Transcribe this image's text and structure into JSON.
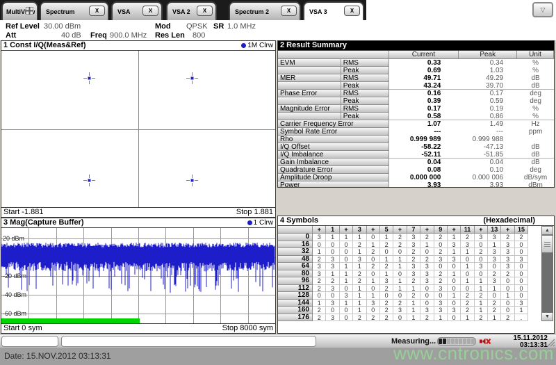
{
  "tabs": {
    "close_label": "X",
    "items": [
      {
        "label": "MultiView",
        "active": false,
        "closable": false
      },
      {
        "label": "Spectrum",
        "active": false,
        "closable": true
      },
      {
        "label": "VSA",
        "active": false,
        "closable": true
      },
      {
        "label": "VSA 2",
        "active": false,
        "closable": true
      },
      {
        "label": "Spectrum 2",
        "active": false,
        "closable": true
      },
      {
        "label": "VSA 3",
        "active": true,
        "closable": true
      }
    ]
  },
  "header": {
    "ref_level_label": "Ref Level",
    "ref_level_value": "30.00 dBm",
    "att_label": "Att",
    "att_value": "40 dB",
    "freq_label": "Freq",
    "freq_value": "900.0 MHz",
    "mod_label": "Mod",
    "mod_value": "QPSK",
    "sr_label": "SR",
    "sr_value": "1.0 MHz",
    "res_len_label": "Res Len",
    "res_len_value": "800"
  },
  "const_window": {
    "title": "1 Const I/Q(Meas&Ref)",
    "trace_label": "1M Clrw",
    "start_label": "Start -1.881",
    "stop_label": "Stop 1.881",
    "points": [
      {
        "x": 0.32,
        "y": 0.175
      },
      {
        "x": 0.695,
        "y": 0.175
      },
      {
        "x": 0.32,
        "y": 0.825
      },
      {
        "x": 0.695,
        "y": 0.825
      }
    ]
  },
  "result_summary": {
    "title": "2 Result Summary",
    "columns": [
      "Current",
      "Peak",
      "Unit"
    ],
    "rows": [
      {
        "label": "EVM",
        "sub": "RMS",
        "current": "0.33",
        "peak": "0.34",
        "unit": "%",
        "span": false,
        "group_end": false
      },
      {
        "label": "",
        "sub": "Peak",
        "current": "0.69",
        "peak": "1.03",
        "unit": "%",
        "span": false,
        "group_end": false
      },
      {
        "label": "MER",
        "sub": "RMS",
        "current": "49.71",
        "peak": "49.29",
        "unit": "dB",
        "span": false,
        "group_end": false
      },
      {
        "label": "",
        "sub": "Peak",
        "current": "43.24",
        "peak": "39.70",
        "unit": "dB",
        "span": false,
        "group_end": true
      },
      {
        "label": "Phase Error",
        "sub": "RMS",
        "current": "0.16",
        "peak": "0.17",
        "unit": "deg",
        "span": false,
        "group_end": false
      },
      {
        "label": "",
        "sub": "Peak",
        "current": "0.39",
        "peak": "0.59",
        "unit": "deg",
        "span": false,
        "group_end": false
      },
      {
        "label": "Magnitude Error",
        "sub": "RMS",
        "current": "0.17",
        "peak": "0.19",
        "unit": "%",
        "span": false,
        "group_end": false
      },
      {
        "label": "",
        "sub": "Peak",
        "current": "0.58",
        "peak": "0.86",
        "unit": "%",
        "span": false,
        "group_end": true
      },
      {
        "label": "Carrier Frequency Error",
        "sub": "",
        "current": "1.07",
        "peak": "1.49",
        "unit": "Hz",
        "span": true,
        "group_end": false
      },
      {
        "label": "Symbol Rate Error",
        "sub": "",
        "current": "---",
        "peak": "---",
        "unit": "ppm",
        "span": true,
        "group_end": false
      },
      {
        "label": "Rho",
        "sub": "",
        "current": "0.999 989",
        "peak": "0.999 988",
        "unit": "",
        "span": true,
        "group_end": false
      },
      {
        "label": "I/Q Offset",
        "sub": "",
        "current": "-58.22",
        "peak": "-47.13",
        "unit": "dB",
        "span": true,
        "group_end": false
      },
      {
        "label": "I/Q Imbalance",
        "sub": "",
        "current": "-52.11",
        "peak": "-51.85",
        "unit": "dB",
        "span": true,
        "group_end": true
      },
      {
        "label": "Gain Imbalance",
        "sub": "",
        "current": "0.04",
        "peak": "0.04",
        "unit": "dB",
        "span": true,
        "group_end": false
      },
      {
        "label": "Quadrature Error",
        "sub": "",
        "current": "0.08",
        "peak": "0.10",
        "unit": "deg",
        "span": true,
        "group_end": false
      },
      {
        "label": "Amplitude Droop",
        "sub": "",
        "current": "0.000 000",
        "peak": "0.000 006",
        "unit": "dB/sym",
        "span": true,
        "group_end": false
      },
      {
        "label": "Power",
        "sub": "",
        "current": "3.93",
        "peak": "3.93",
        "unit": "dBm",
        "span": true,
        "group_end": false
      }
    ]
  },
  "mag_window": {
    "title": "3 Mag(Capture Buffer)",
    "trace_label": "1 Clrw",
    "start_label": "Start 0 sym",
    "stop_label": "Stop 8000 sym"
  },
  "symbols": {
    "title": "4 Symbols",
    "subtitle": "(Hexadecimal)",
    "col_headers": [
      "+",
      "1",
      "+",
      "3",
      "+",
      "5",
      "+",
      "7",
      "+",
      "9",
      "+",
      "11",
      "+",
      "13",
      "+",
      "15"
    ],
    "rows": [
      {
        "index": "0",
        "values": [
          "3",
          "1",
          "1",
          "1",
          "0",
          "1",
          "2",
          "3",
          "2",
          "2",
          "1",
          "2",
          "3",
          "3",
          "2",
          "2"
        ]
      },
      {
        "index": "16",
        "values": [
          "0",
          "0",
          "0",
          "2",
          "1",
          "2",
          "2",
          "3",
          "1",
          "0",
          "3",
          "3",
          "0",
          "1",
          "3",
          "0"
        ]
      },
      {
        "index": "32",
        "values": [
          "1",
          "0",
          "0",
          "1",
          "2",
          "0",
          "0",
          "2",
          "0",
          "2",
          "1",
          "1",
          "2",
          "3",
          "3",
          "0"
        ]
      },
      {
        "index": "48",
        "values": [
          "2",
          "3",
          "0",
          "3",
          "0",
          "1",
          "1",
          "2",
          "2",
          "3",
          "3",
          "0",
          "0",
          "3",
          "3",
          "3"
        ]
      },
      {
        "index": "64",
        "values": [
          "3",
          "3",
          "1",
          "1",
          "2",
          "2",
          "1",
          "3",
          "3",
          "0",
          "0",
          "1",
          "3",
          "0",
          "3",
          "0"
        ]
      },
      {
        "index": "80",
        "values": [
          "3",
          "1",
          "1",
          "2",
          "0",
          "1",
          "0",
          "3",
          "3",
          "2",
          "1",
          "0",
          "0",
          "2",
          "2",
          "0"
        ]
      },
      {
        "index": "96",
        "values": [
          "2",
          "2",
          "1",
          "2",
          "1",
          "3",
          "1",
          "2",
          "3",
          "2",
          "0",
          "1",
          "1",
          "3",
          "0",
          "0"
        ]
      },
      {
        "index": "112",
        "values": [
          "2",
          "3",
          "0",
          "1",
          "0",
          "2",
          "1",
          "1",
          "0",
          "3",
          "0",
          "0",
          "1",
          "1",
          "0",
          "0"
        ]
      },
      {
        "index": "128",
        "values": [
          "0",
          "0",
          "3",
          "1",
          "1",
          "0",
          "0",
          "2",
          "0",
          "0",
          "1",
          "2",
          "2",
          "0",
          "1",
          "0"
        ]
      },
      {
        "index": "144",
        "values": [
          "1",
          "3",
          "1",
          "1",
          "3",
          "2",
          "2",
          "1",
          "0",
          "3",
          "0",
          "2",
          "1",
          "2",
          "0",
          "3"
        ]
      },
      {
        "index": "160",
        "values": [
          "2",
          "0",
          "0",
          "1",
          "0",
          "2",
          "3",
          "1",
          "3",
          "3",
          "3",
          "2",
          "1",
          "2",
          "0",
          "1"
        ]
      },
      {
        "index": "176",
        "values": [
          "2",
          "3",
          "0",
          "2",
          "2",
          "2",
          "0",
          "1",
          "2",
          "1",
          "0",
          "1",
          "2",
          "1",
          "2",
          "."
        ]
      }
    ]
  },
  "statusbar": {
    "measuring_label": "Measuring...",
    "progress_percent": 20,
    "progress_segments": 9,
    "date": "15.11.2012",
    "time": "03:13:31"
  },
  "desktop": {
    "date_text": "Date: 15.NOV.2012  03:13:31",
    "watermark": "www.cntronics.com"
  },
  "colors": {
    "trace_blue": "#1d1dc9",
    "capture_green": "#00d400",
    "active_title_bg": "#000000",
    "watermark_green": "#96d696"
  },
  "chart_data": [
    {
      "type": "scatter",
      "title": "Const I/Q(Meas&Ref)",
      "x_range": [
        -1.881,
        1.881
      ],
      "points_iq": [
        {
          "i": -1,
          "q": 1
        },
        {
          "i": 1,
          "q": 1
        },
        {
          "i": -1,
          "q": -1
        },
        {
          "i": 1,
          "q": -1
        }
      ],
      "note": "QPSK constellation, 4 measured symbol points on crosshair axes"
    },
    {
      "type": "area",
      "title": "Mag(Capture Buffer)",
      "xlabel": "sym",
      "x_range": [
        0,
        8000
      ],
      "ylabel": "dBm",
      "y_ticks": [
        {
          "label": "20 dBm",
          "v": 20
        },
        {
          "label": "-20 dBm",
          "v": -20
        },
        {
          "label": "-40 dBm",
          "v": -40
        },
        {
          "label": "-60 dBm",
          "v": -60
        }
      ],
      "ylim": [
        31,
        -71
      ],
      "band_top_dbm": 13,
      "band_bottom_dbm": -10,
      "spike_min_dbm": -38,
      "spike_probability": 0.16,
      "grid": true,
      "capture_bar_fraction": 0.505
    }
  ]
}
